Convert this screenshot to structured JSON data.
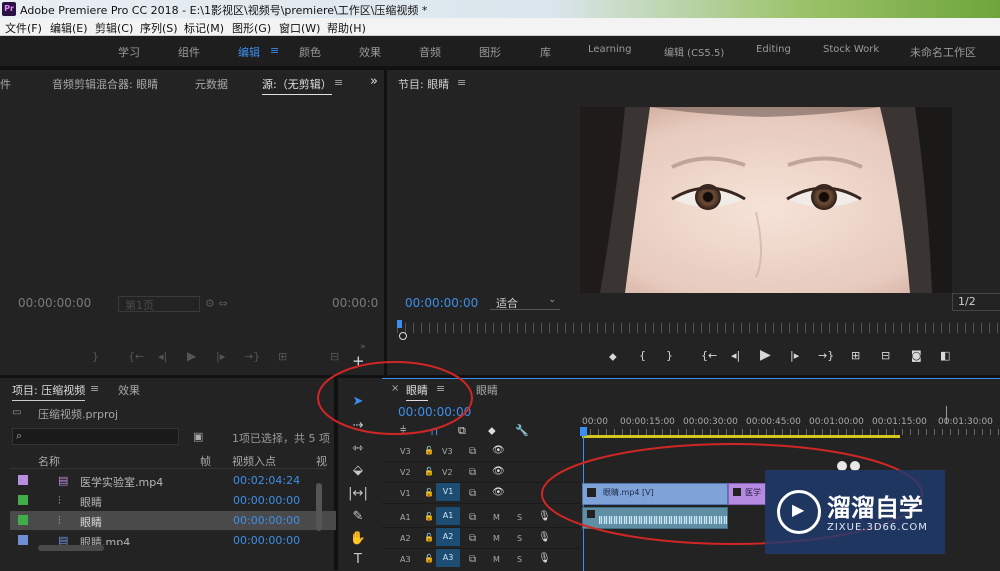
{
  "window": {
    "title": "Adobe Premiere Pro CC 2018 - E:\\1影视区\\视频号\\premiere\\工作区\\压缩视频 *",
    "app_icon": "Pr"
  },
  "menu": [
    "文件(F)",
    "编辑(E)",
    "剪辑(C)",
    "序列(S)",
    "标记(M)",
    "图形(G)",
    "窗口(W)",
    "帮助(H)"
  ],
  "workspaces": {
    "items": [
      "学习",
      "组件",
      "编辑",
      "颜色",
      "效果",
      "音频",
      "图形",
      "库",
      "Learning",
      "编辑 (CS5.5)",
      "Editing",
      "Stock Work",
      "未命名工作区"
    ],
    "active": "编辑",
    "active_menu_glyph": "≡"
  },
  "source_panel": {
    "tabs": [
      "件",
      "音频剪辑混合器: 眼睛",
      "元数据",
      "源:（无剪辑）"
    ],
    "tab_menu": "≡",
    "overflow": "»",
    "timecode_left": "00:00:00:00",
    "page_select": "第1页",
    "timecode_right": "00:00:0"
  },
  "program_panel": {
    "title": "节目: 眼睛",
    "title_menu": "≡",
    "timecode": "00:00:00:00",
    "fit": "适合",
    "resolution": "1/2"
  },
  "project_panel": {
    "tabs": [
      "项目: 压缩视频",
      "效果"
    ],
    "tab_menu": "≡",
    "file": "压缩视频.prproj",
    "selection_info": "1项已选择，共 5 项",
    "columns": [
      "名称",
      "帧",
      "视频入点",
      "视"
    ],
    "items": [
      {
        "name": "医学实验室.mp4",
        "in": "00:02:04:24",
        "color": "#b98de0",
        "icon": "film-icon"
      },
      {
        "name": "眼睛",
        "in": "00:00:00:00",
        "color": "#3fae49",
        "icon": "sequence-icon"
      },
      {
        "name": "眼睛",
        "in": "00:00:00:00",
        "color": "#3fae49",
        "icon": "sequence-icon",
        "selected": true
      },
      {
        "name": "眼睛.mp4",
        "in": "00:00:00:00",
        "color": "#6e8fd6",
        "icon": "film-icon"
      }
    ]
  },
  "timeline": {
    "tab": "眼睛",
    "tab_menu": "≡",
    "tab2": "眼睛",
    "close": "×",
    "timecode": "00:00:00:00",
    "ruler": [
      "00:00",
      "00:00:15:00",
      "00:00:30:00",
      "00:00:45:00",
      "00:01:00:00",
      "00:01:15:00",
      "00:01:30:00"
    ],
    "video_tracks": [
      "V3",
      "V2",
      "V1"
    ],
    "audio_tracks": [
      "A1",
      "A2",
      "A3"
    ],
    "clip_video": "眼睛.mp4 [V]",
    "clip_video2": "医学",
    "mute": "M",
    "solo": "S"
  },
  "watermark": {
    "title": "溜溜自学",
    "url": "ZIXUE.3D66.COM"
  },
  "annotation_color": "#d02626"
}
